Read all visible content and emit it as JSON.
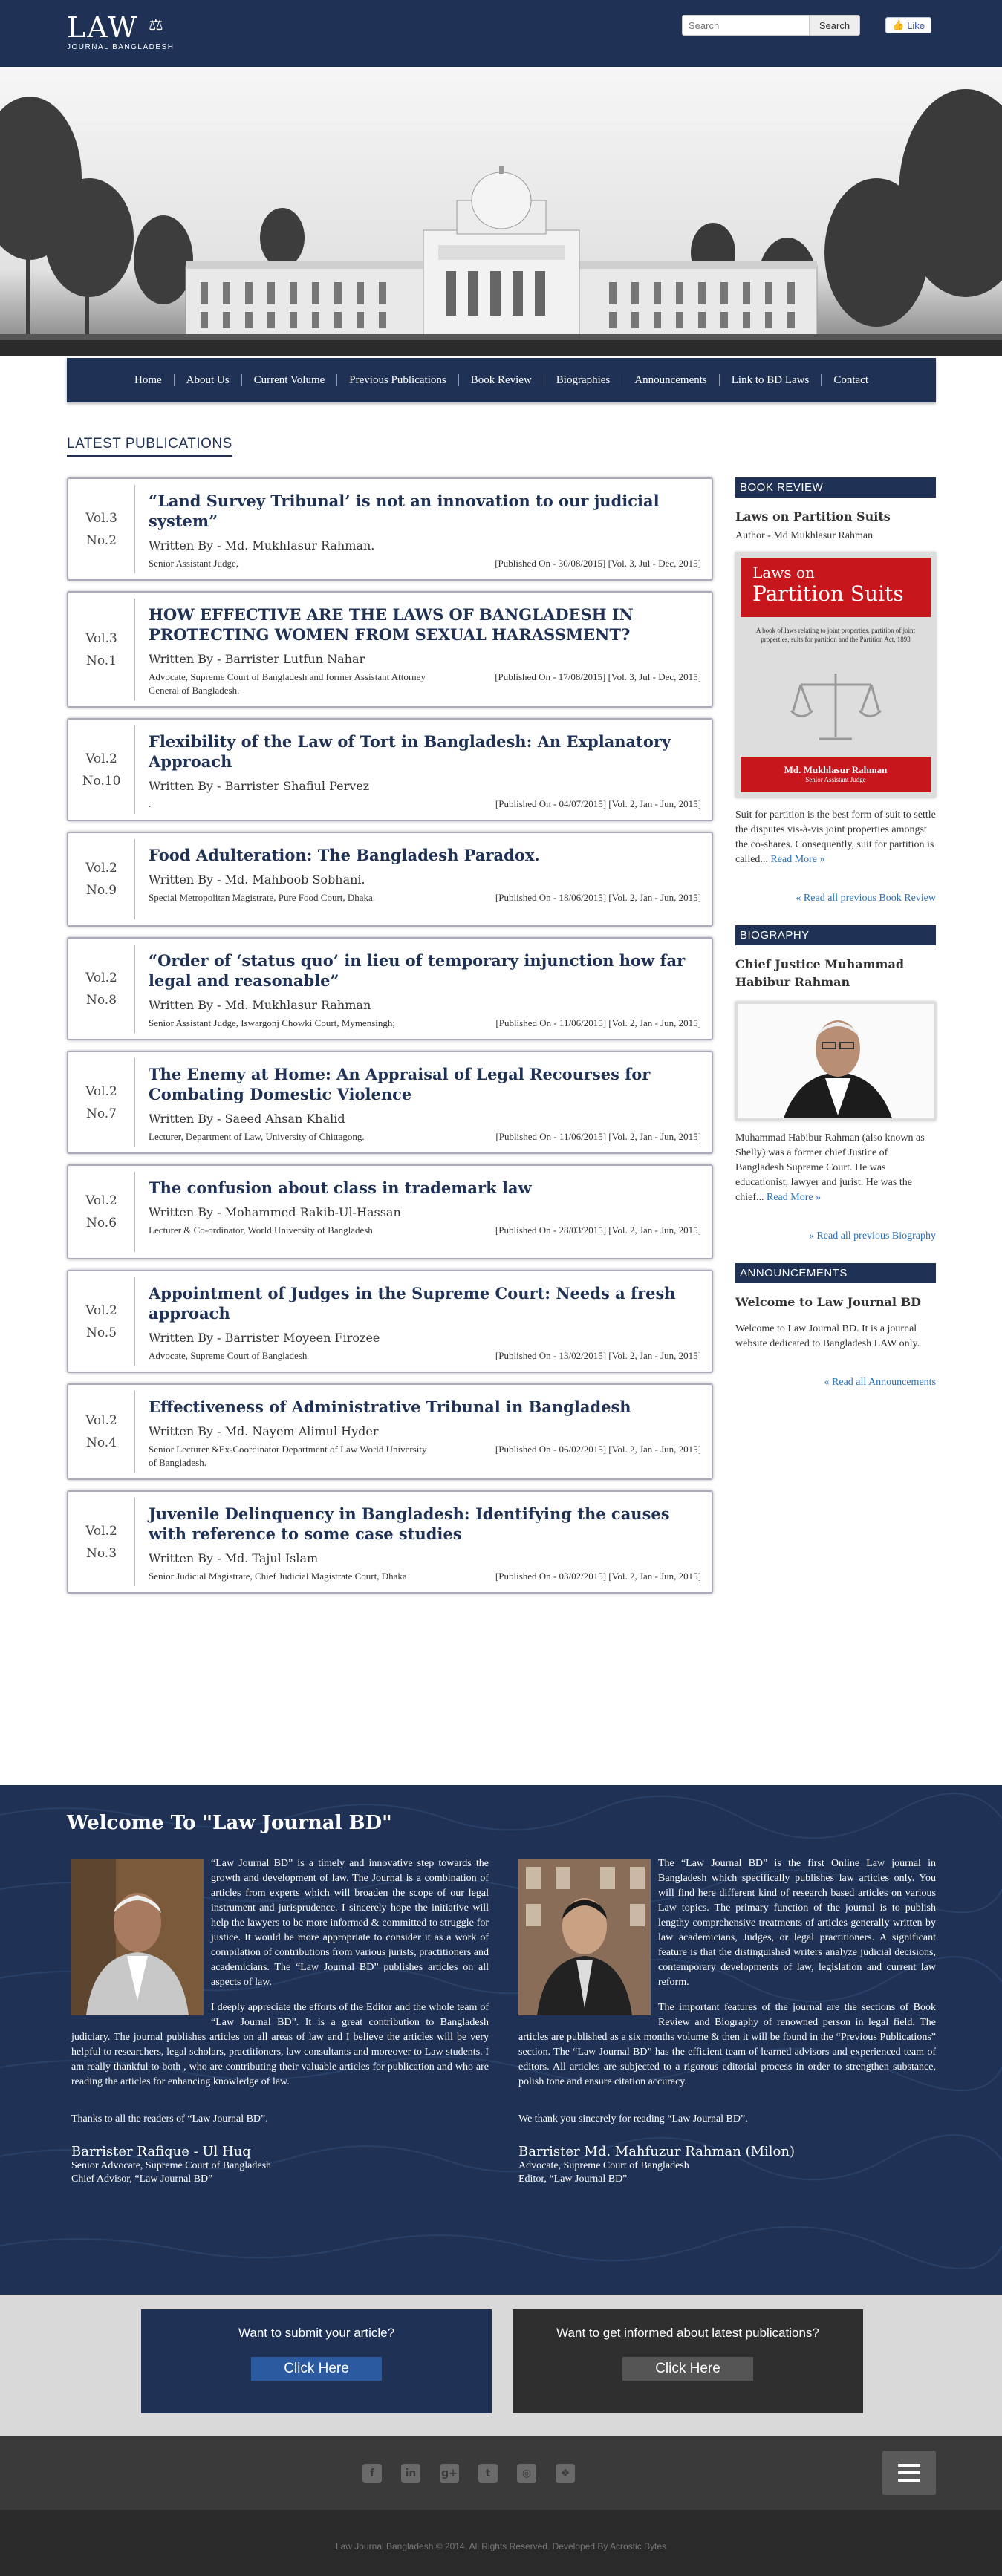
{
  "header": {
    "logo_main": "LAW",
    "logo_sub": "JOURNAL BANGLADESH",
    "search_placeholder": "Search",
    "search_button": "Search",
    "like_label": "Like"
  },
  "nav": [
    "Home",
    "About Us",
    "Current Volume",
    "Previous Publications",
    "Book Review",
    "Biographies",
    "Announcements",
    "Link to BD Laws",
    "Contact"
  ],
  "latest_title": "LATEST PUBLICATIONS",
  "publications": [
    {
      "vol": "Vol.3",
      "no": "No.2",
      "title": "“Land Survey Tribunal’ is not an innovation to our judicial system”",
      "author": "Written By - Md. Mukhlasur Rahman.",
      "designation": "Senior Assistant Judge,",
      "published": "[Published On - 30/08/2015] [Vol. 3, Jul - Dec, 2015]"
    },
    {
      "vol": "Vol.3",
      "no": "No.1",
      "title": "HOW EFFECTIVE ARE THE LAWS OF BANGLADESH IN PROTECTING WOMEN FROM SEXUAL HARASSMENT?",
      "author": "Written By - Barrister Lutfun Nahar",
      "designation": "Advocate, Supreme Court of Bangladesh and former Assistant Attorney General of Bangladesh.",
      "published": "[Published On - 17/08/2015] [Vol. 3, Jul - Dec, 2015]"
    },
    {
      "vol": "Vol.2",
      "no": "No.10",
      "title": "Flexibility of the Law of Tort in Bangladesh: An Explanatory Approach",
      "author": "Written By - Barrister Shafiul Pervez",
      "designation": ".",
      "published": "[Published On - 04/07/2015] [Vol. 2, Jan - Jun, 2015]"
    },
    {
      "vol": "Vol.2",
      "no": "No.9",
      "title": "Food Adulteration: The Bangladesh Paradox.",
      "author": "Written By - Md. Mahboob Sobhani.",
      "designation": "Special Metropolitan Magistrate, Pure Food Court, Dhaka.",
      "published": "[Published On - 18/06/2015] [Vol. 2, Jan - Jun, 2015]"
    },
    {
      "vol": "Vol.2",
      "no": "No.8",
      "title": "“Order of ‘status quo’ in lieu of temporary injunction how far legal and reasonable”",
      "author": "Written By - Md. Mukhlasur Rahman",
      "designation": "Senior Assistant Judge, Iswargonj Chowki Court, Mymensingh;",
      "published": "[Published On - 11/06/2015] [Vol. 2, Jan - Jun, 2015]"
    },
    {
      "vol": "Vol.2",
      "no": "No.7",
      "title": "The Enemy at Home: An Appraisal of Legal Recourses for Combating Domestic Violence",
      "author": "Written By - Saeed Ahsan Khalid",
      "designation": "Lecturer, Department of Law, University of Chittagong.",
      "published": "[Published On - 11/06/2015] [Vol. 2, Jan - Jun, 2015]"
    },
    {
      "vol": "Vol.2",
      "no": "No.6",
      "title": "The confusion about class in trademark law",
      "author": "Written By - Mohammed Rakib-Ul-Hassan",
      "designation": "Lecturer & Co-ordinator, World University of Bangladesh",
      "published": "[Published On - 28/03/2015] [Vol. 2, Jan - Jun, 2015]"
    },
    {
      "vol": "Vol.2",
      "no": "No.5",
      "title": "Appointment of Judges in the Supreme Court: Needs a fresh approach",
      "author": "Written By - Barrister Moyeen Firozee",
      "designation": "Advocate, Supreme Court of Bangladesh",
      "published": "[Published On - 13/02/2015] [Vol. 2, Jan - Jun, 2015]"
    },
    {
      "vol": "Vol.2",
      "no": "No.4",
      "title": "Effectiveness of Administrative Tribunal in Bangladesh",
      "author": "Written By - Md. Nayem Alimul Hyder",
      "designation": "Senior Lecturer &Ex-Coordinator Department of Law World University of Bangladesh.",
      "published": "[Published On - 06/02/2015] [Vol. 2, Jan - Jun, 2015]"
    },
    {
      "vol": "Vol.2",
      "no": "No.3",
      "title": "Juvenile Delinquency in Bangladesh: Identifying the causes with reference to some case studies",
      "author": "Written By - Md. Tajul Islam",
      "designation": "Senior Judicial Magistrate, Chief Judicial Magistrate Court, Dhaka",
      "published": "[Published On - 03/02/2015] [Vol. 2, Jan - Jun, 2015]"
    }
  ],
  "sidebar": {
    "book_review": {
      "heading": "BOOK REVIEW",
      "title": "Laws on Partition Suits",
      "author": "Author - Md Mukhlasur Rahman",
      "cover_top": "Laws on",
      "cover_title": "Partition Suits",
      "cover_desc": "A book of laws relating to joint properties, partition of joint properties, suits for partition and the Partition Act, 1893",
      "cover_author": "Md. Mukhlasur Rahman",
      "cover_author_sub": "Senior Assistant Judge",
      "text": "Suit for partition is the best form of suit to settle the disputes vis-à-vis joint properties amongst the co-shares. Consequently, suit for partition is called...",
      "read_more": "Read More »",
      "all_link": "« Read all previous Book Review"
    },
    "biography": {
      "heading": "BIOGRAPHY",
      "title": "Chief Justice Muhammad Habibur Rahman",
      "text": "Muhammad Habibur Rahman (also known as Shelly) was a former chief Justice of Bangladesh Supreme Court. He was  educationist, lawyer and jurist. He was the chief...",
      "read_more": "Read More »",
      "all_link": "« Read all previous Biography"
    },
    "announcements": {
      "heading": "ANNOUNCEMENTS",
      "title": "Welcome to Law Journal BD",
      "text": "Welcome to Law Journal BD. It is a journal website dedicated to Bangladesh LAW only.",
      "all_link": "« Read all Announcements"
    }
  },
  "welcome": {
    "title": "Welcome To \"Law Journal BD\"",
    "left": {
      "p1": "“Law Journal BD” is a timely and innovative step towards the growth and development of law. The Journal is a combination of articles from experts which will broaden the scope of our legal instrument and jurisprudence. I sincerely hope the initiative will help the lawyers to be more informed & committed to struggle for justice. It would be more appropriate to consider it as a work of compilation of contributions from various jurists, practitioners and academicians. The “Law Journal BD” publishes articles on all aspects of law.",
      "p2": "I deeply appreciate the efforts of the Editor and the whole team of “Law Journal BD”. It is a great contribution to Bangladesh judiciary. The journal publishes articles on all areas of law and I believe the articles will be very helpful to researchers, legal scholars, practitioners, law consultants and moreover to Law students. I am really thankful to both , who are contributing their valuable articles for publication and who are reading the articles for enhancing knowledge of law.",
      "thanks": "Thanks to all the readers of “Law Journal BD”.",
      "name": "Barrister Rafique - Ul Huq",
      "d1": "Senior Advocate, Supreme Court of Bangladesh",
      "d2": "Chief Advisor, “Law Journal BD”"
    },
    "right": {
      "p1": "The “Law Journal BD” is the first Online Law journal in Bangladesh which specifically publishes law articles only. You will find here different kind of research based articles on various Law topics. The primary function of the journal is to publish lengthy comprehensive treatments of articles generally written by law academicians, Judges, or legal practitioners. A significant feature is that the distinguished writers analyze judicial decisions, contemporary developments of law, legislation and current law reform.",
      "p2": "The important features of the journal are the sections of Book Review and Biography of renowned person in legal field. The articles are published as a six months volume & then it will be found in the “Previous Publications” section. The “Law Journal BD” has the efficient team of learned advisors and experienced team of editors. All articles are subjected to a rigorous editorial process in order to strengthen substance, polish tone and ensure citation accuracy.",
      "thanks": "We thank you sincerely for reading “Law Journal BD”.",
      "name": "Barrister Md. Mahfuzur Rahman (Milon)",
      "d1": "Advocate, Supreme Court of Bangladesh",
      "d2": "Editor, “Law Journal BD”"
    }
  },
  "cta": {
    "submit_q": "Want to submit your article?",
    "submit_btn": "Click Here",
    "inform_q": "Want to get informed about latest publications?",
    "inform_btn": "Click Here"
  },
  "footer": {
    "social_icons": [
      "facebook-icon",
      "linkedin-icon",
      "google-plus-icon",
      "twitter-icon",
      "instagram-icon",
      "dropbox-icon"
    ],
    "copyright": "Law Journal Bangladesh © 2014. All Rights Reserved. Developed By Acrostic Bytes"
  },
  "colors": {
    "navy": "#1f3256",
    "cta_left": "#1f3256",
    "cta_right": "#2f2f2f",
    "book_red": "#c8161d",
    "link": "#2c6fb7"
  }
}
